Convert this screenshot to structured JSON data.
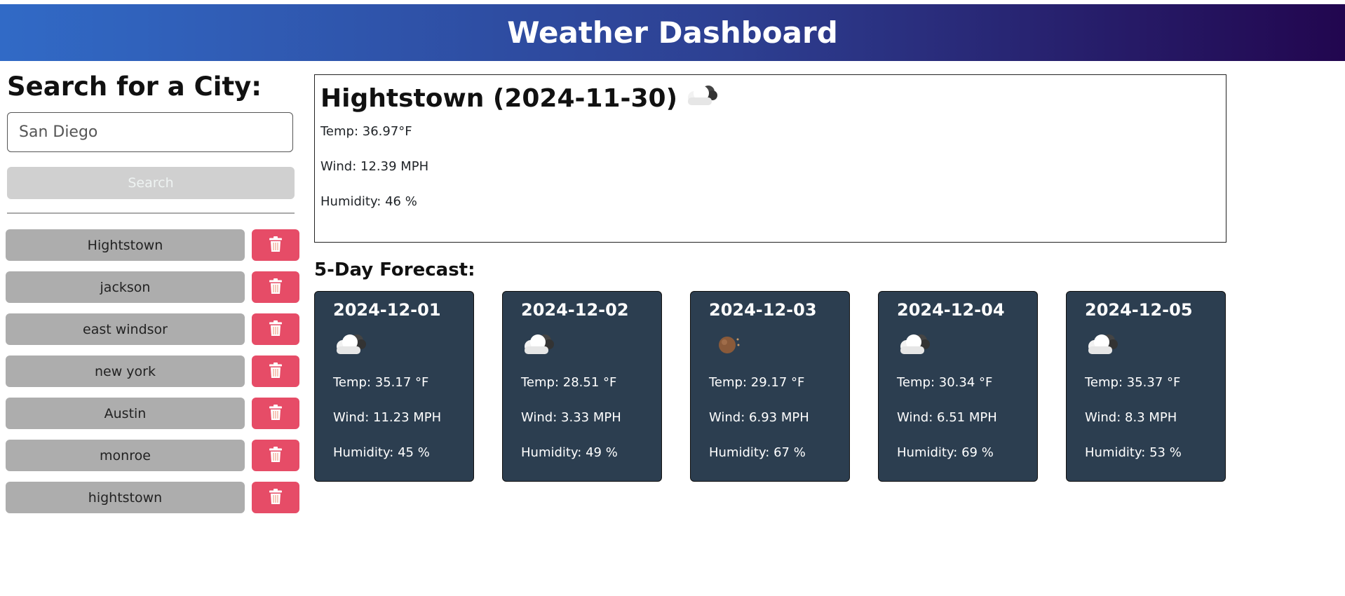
{
  "header": {
    "title": "Weather Dashboard"
  },
  "sidebar": {
    "heading": "Search for a City:",
    "input_value": "San Diego",
    "search_label": "Search",
    "cities": [
      "Hightstown",
      "jackson",
      "east windsor",
      "new york",
      "Austin",
      "monroe",
      "hightstown"
    ]
  },
  "current": {
    "title": "Hightstown (2024-11-30)",
    "icon": "cloud-icon",
    "temp": "Temp: 36.97°F",
    "wind": "Wind: 12.39 MPH",
    "humidity": "Humidity: 46 %"
  },
  "forecast": {
    "title": "5-Day Forecast:",
    "days": [
      {
        "date": "2024-12-01",
        "icon": "cloud-icon",
        "temp": "Temp: 35.17 °F",
        "wind": "Wind: 11.23 MPH",
        "humidity": "Humidity: 45 %"
      },
      {
        "date": "2024-12-02",
        "icon": "cloud-icon",
        "temp": "Temp: 28.51 °F",
        "wind": "Wind: 3.33 MPH",
        "humidity": "Humidity: 49 %"
      },
      {
        "date": "2024-12-03",
        "icon": "clear-night-icon",
        "temp": "Temp: 29.17 °F",
        "wind": "Wind: 6.93 MPH",
        "humidity": "Humidity: 67 %"
      },
      {
        "date": "2024-12-04",
        "icon": "cloud-icon",
        "temp": "Temp: 30.34 °F",
        "wind": "Wind: 6.51 MPH",
        "humidity": "Humidity: 69 %"
      },
      {
        "date": "2024-12-05",
        "icon": "cloud-icon",
        "temp": "Temp: 35.37 °F",
        "wind": "Wind: 8.3 MPH",
        "humidity": "Humidity: 53 %"
      }
    ]
  },
  "colors": {
    "delete": "#e64c67",
    "card": "#2c3e50",
    "city_button": "#adadad"
  }
}
